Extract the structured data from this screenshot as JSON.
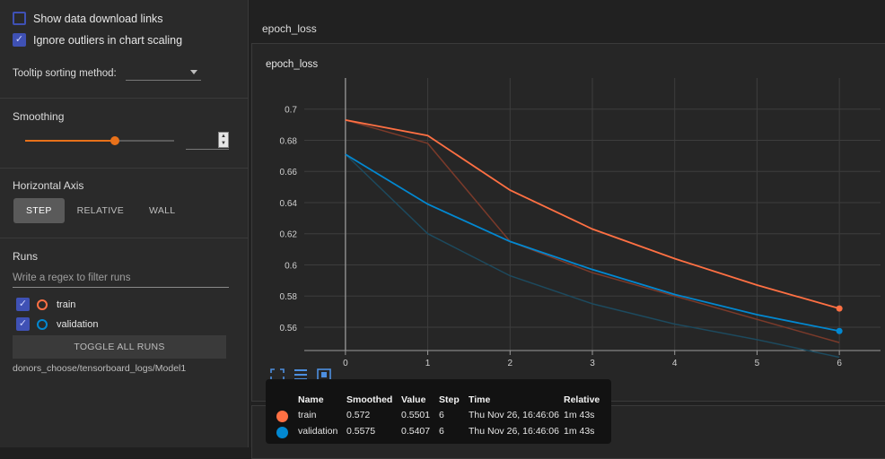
{
  "sidebar": {
    "show_download_links": {
      "label": "Show data download links",
      "checked": false
    },
    "ignore_outliers": {
      "label": "Ignore outliers in chart scaling",
      "checked": true
    },
    "tooltip_sorting": {
      "label": "Tooltip sorting method:",
      "value": ""
    },
    "smoothing": {
      "title": "Smoothing",
      "value": 0.6,
      "input_value": ""
    },
    "horizontal_axis": {
      "title": "Horizontal Axis",
      "options": [
        "STEP",
        "RELATIVE",
        "WALL"
      ],
      "selected": "STEP"
    },
    "runs": {
      "title": "Runs",
      "filter_placeholder": "Write a regex to filter runs",
      "items": [
        {
          "name": "train",
          "color": "#ff7043",
          "checked": true
        },
        {
          "name": "validation",
          "color": "#0288d1",
          "checked": true
        }
      ],
      "toggle_label": "TOGGLE ALL RUNS",
      "logdir": "donors_choose/tensorboard_logs/Model1"
    }
  },
  "main": {
    "group_title": "epoch_loss",
    "card_title": "epoch_loss"
  },
  "chart_data": {
    "type": "line",
    "title": "epoch_loss",
    "x_ticks": [
      "0",
      "1",
      "2",
      "3",
      "4",
      "5",
      "6"
    ],
    "y_ticks": [
      "0.56",
      "0.58",
      "0.6",
      "0.62",
      "0.64",
      "0.66",
      "0.68",
      "0.7"
    ],
    "xlim": [
      -0.5,
      6.5
    ],
    "ylim": [
      0.545,
      0.72
    ],
    "grid": true,
    "series": [
      {
        "name": "train",
        "color": "#ff7043",
        "raw_color": "#7a3a2a",
        "x": [
          0,
          1,
          2,
          3,
          4,
          5,
          6
        ],
        "smoothed": [
          0.693,
          0.683,
          0.648,
          0.623,
          0.604,
          0.587,
          0.572
        ],
        "raw": [
          0.693,
          0.678,
          0.615,
          0.595,
          0.58,
          0.565,
          0.5501
        ]
      },
      {
        "name": "validation",
        "color": "#0288d1",
        "raw_color": "#1d4a5e",
        "x": [
          0,
          1,
          2,
          3,
          4,
          5,
          6
        ],
        "smoothed": [
          0.671,
          0.639,
          0.615,
          0.597,
          0.581,
          0.568,
          0.5575
        ],
        "raw": [
          0.671,
          0.62,
          0.593,
          0.575,
          0.562,
          0.552,
          0.5407
        ]
      }
    ]
  },
  "tooltip": {
    "headers": [
      "Name",
      "Smoothed",
      "Value",
      "Step",
      "Time",
      "Relative"
    ],
    "rows": [
      {
        "color": "#ff7043",
        "name": "train",
        "smoothed": "0.572",
        "value": "0.5501",
        "step": "6",
        "time": "Thu Nov 26, 16:46:06",
        "relative": "1m 43s"
      },
      {
        "color": "#0288d1",
        "name": "validation",
        "smoothed": "0.5575",
        "value": "0.5407",
        "step": "6",
        "time": "Thu Nov 26, 16:46:06",
        "relative": "1m 43s"
      }
    ]
  }
}
